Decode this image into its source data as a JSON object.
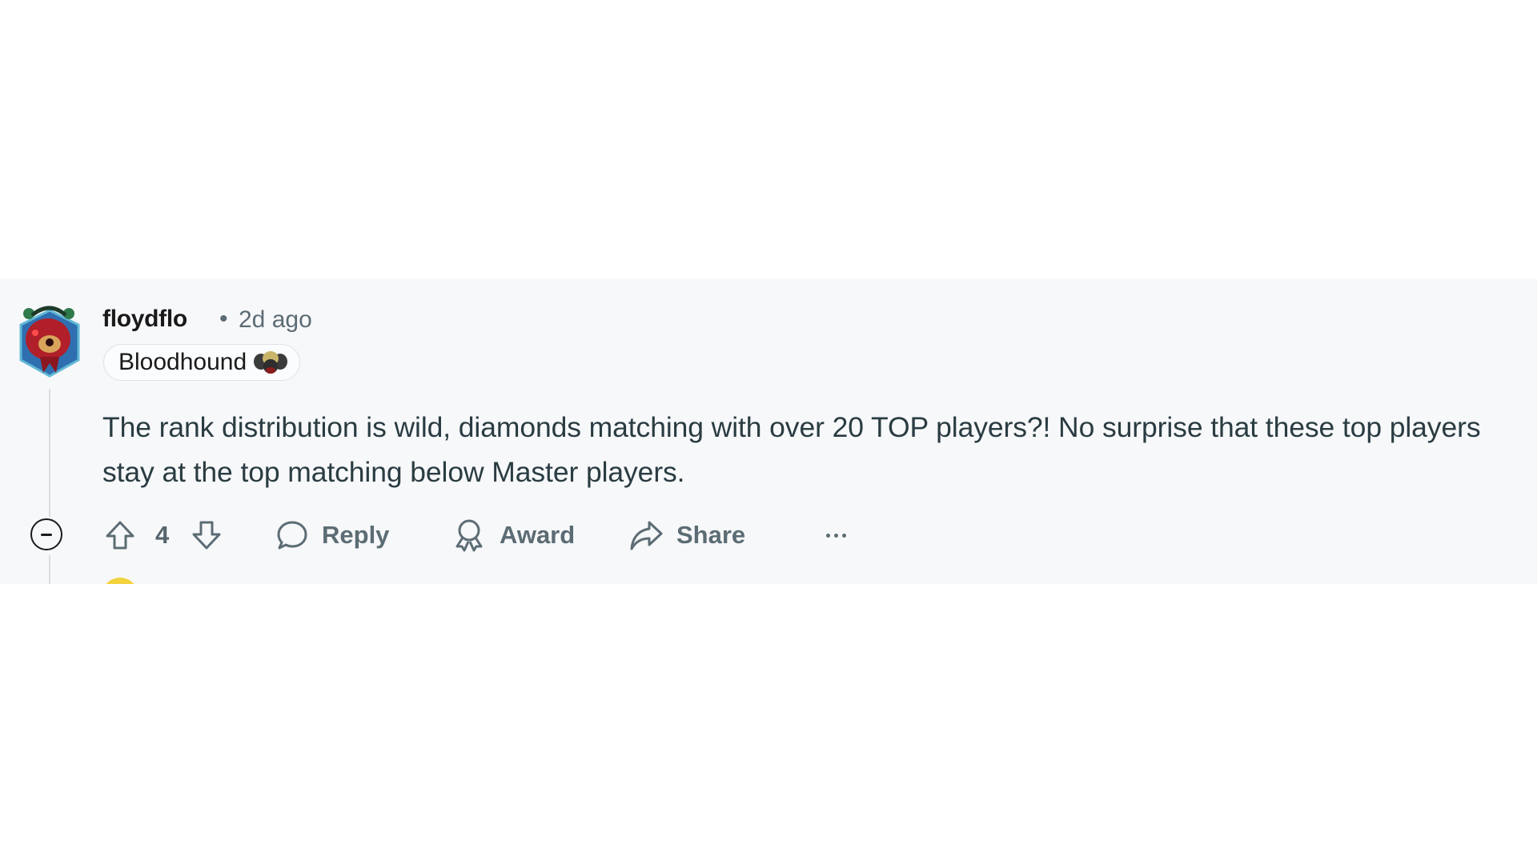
{
  "comment": {
    "author": "floydflo",
    "separator": "•",
    "timestamp": "2d ago",
    "flair": {
      "text": "Bloodhound",
      "icon": "bloodhound-emoji-icon"
    },
    "body": "The rank distribution is wild, diamonds matching with over 20 TOP players?! No surprise that these top players stay at the top matching below Master players.",
    "score": "4",
    "actions": {
      "reply": "Reply",
      "award": "Award",
      "share": "Share"
    }
  },
  "colors": {
    "band_background": "#f7f8fa",
    "meta_text": "#5c6c74",
    "next_avatar": "#f2d33c"
  }
}
